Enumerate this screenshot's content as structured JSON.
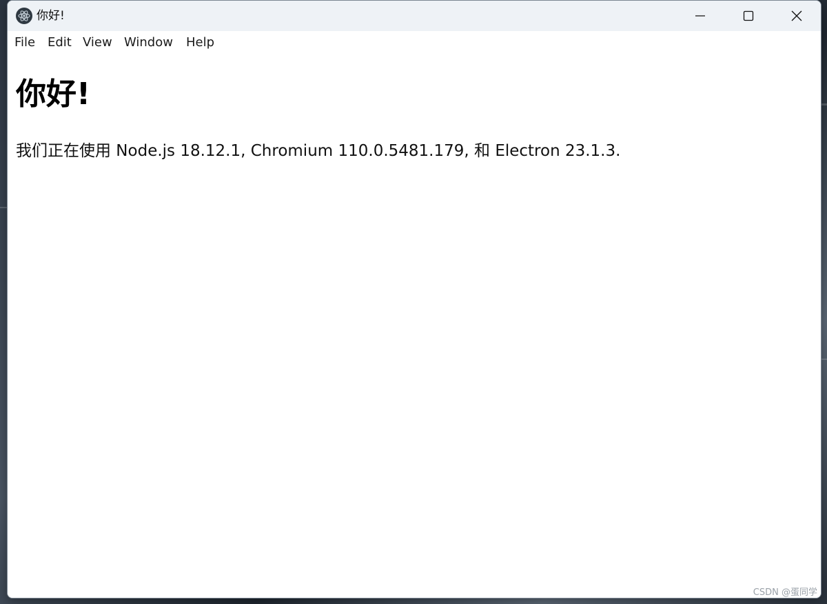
{
  "window": {
    "title": "你好!",
    "icon": "electron-icon"
  },
  "controls": {
    "minimize": "minimize-icon",
    "maximize": "maximize-icon",
    "close": "close-icon"
  },
  "menu": {
    "items": [
      {
        "label": "File"
      },
      {
        "label": "Edit"
      },
      {
        "label": "View"
      },
      {
        "label": "Window"
      },
      {
        "label": "Help"
      }
    ]
  },
  "page": {
    "heading": "你好!",
    "text": "我们正在使用 Node.js 18.12.1, Chromium 110.0.5481.179, 和 Electron 23.1.3."
  },
  "watermark": "CSDN @蛋同学",
  "colors": {
    "titlebar": "#eef2f6",
    "background": "#ffffff"
  }
}
